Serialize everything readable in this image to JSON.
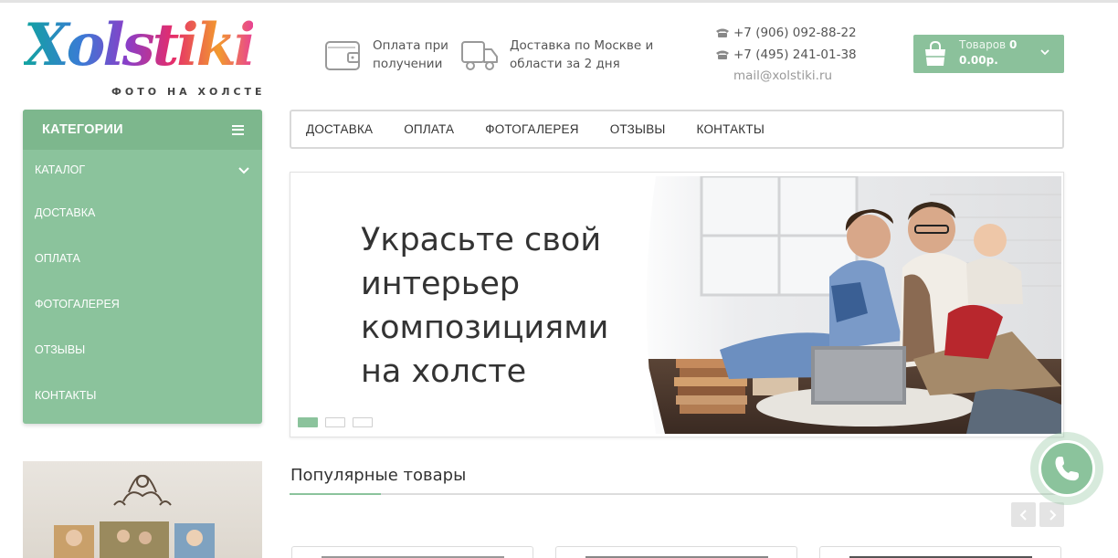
{
  "logo": {
    "word": "Xolstiki",
    "subtitle": "ФОТО НА ХОЛСТЕ"
  },
  "header": {
    "payment_info": "Оплата при получении",
    "delivery_info": "Доставка по Москве и области за 2 дня",
    "phone1": "+7 (906) 092-88-22",
    "phone2": "+7 (495) 241-01-38",
    "email": "mail@xolstiki.ru",
    "cart": {
      "label": "Товаров",
      "count": "0",
      "total": "0.00р."
    }
  },
  "sidebar": {
    "title": "КАТЕГОРИИ",
    "items": [
      {
        "label": "КАТАЛОГ"
      },
      {
        "label": "ДОСТАВКА"
      },
      {
        "label": "ОПЛАТА"
      },
      {
        "label": "ФОТОГАЛЕРЕЯ"
      },
      {
        "label": "ОТЗЫВЫ"
      },
      {
        "label": "КОНТАКТЫ"
      }
    ]
  },
  "nav": {
    "items": [
      {
        "label": "ДОСТАВКА"
      },
      {
        "label": "ОПЛАТА"
      },
      {
        "label": "ФОТОГАЛЕРЕЯ"
      },
      {
        "label": "ОТЗЫВЫ"
      },
      {
        "label": "КОНТАКТЫ"
      }
    ]
  },
  "slider": {
    "lines": [
      "Украсьте свой",
      "интерьер",
      "композициями",
      "на холсте"
    ],
    "slide_count": 3,
    "active_slide": 1
  },
  "popular": {
    "title": "Популярные товары"
  },
  "colors": {
    "accent": "#8bc39c",
    "accent_dark": "#7db78d"
  },
  "icons": [
    "wallet-icon",
    "truck-icon",
    "phone-icon",
    "shopping-bag-icon",
    "chevron-down-icon",
    "hamburger-icon",
    "arrow-left-icon",
    "arrow-right-icon",
    "call-icon"
  ]
}
